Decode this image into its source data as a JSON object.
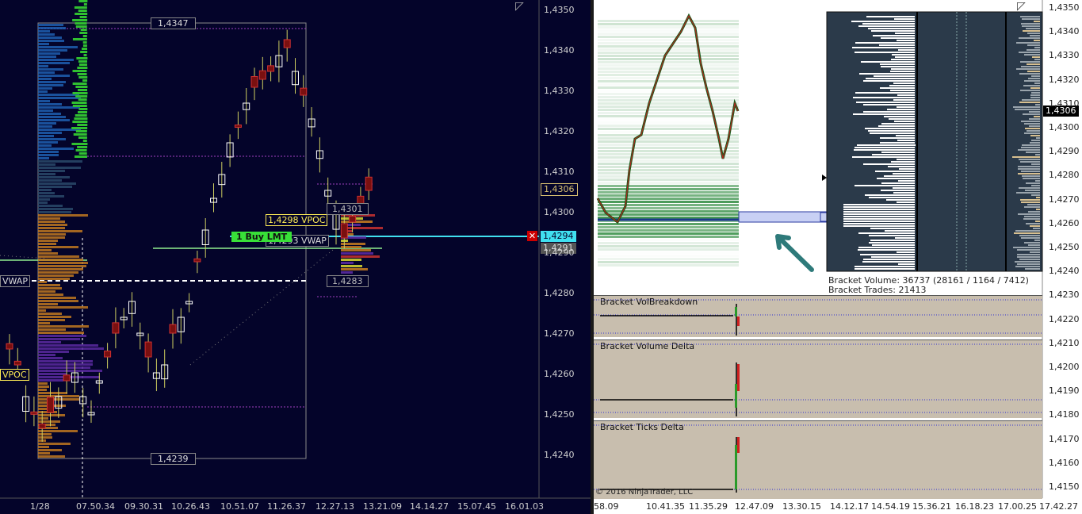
{
  "left_chart": {
    "y_ticks": [
      "1,4350",
      "1,4340",
      "1,4330",
      "1,4320",
      "1,4310",
      "1,4300",
      "1,4290",
      "1,4280",
      "1,4270",
      "1,4260",
      "1,4250",
      "1,4240"
    ],
    "x_ticks": [
      "1/28",
      "07.50.34",
      "09.30.31",
      "10.26.43",
      "10.51.07",
      "11.26.37",
      "12.27.13",
      "13.21.09",
      "14.14.27",
      "15.07.45",
      "16.01.03"
    ],
    "range_high_label": "1,4347",
    "range_low_label": "1,4239",
    "vpoc_label": "1,4298 VPOC",
    "vwap_label": "1,4293 VWAP",
    "order_label": "1  Buy LMT",
    "small_high_label": "1,4301",
    "small_low_label": "1,4283",
    "left_vwap_label": "VWAP",
    "left_vpoc_label": "VPOC",
    "price_tag_last": "1,4306",
    "price_tag_order": "1,4294",
    "price_tag_vwap": "1,4291"
  },
  "right_chart": {
    "y_ticks": [
      "1,4350",
      "1,4340",
      "1,4330",
      "1,4320",
      "1,4310",
      "1,4300",
      "1,4290",
      "1,4280",
      "1,4270",
      "1,4260",
      "1,4250",
      "1,4240",
      "1,4230",
      "1,4220",
      "1,4210",
      "1,4200",
      "1,4190",
      "1,4180",
      "1,4170",
      "1,4160",
      "1,4150"
    ],
    "x_ticks": [
      "58.09",
      "10.41.35",
      "11.35.29",
      "12.47.09",
      "13.30.15",
      "14.12.17",
      "14.54.19",
      "15.36.21",
      "16.18.23",
      "17.00.25",
      "17.42.27"
    ],
    "last_price_tag": "1,4306",
    "bracket_volume": "Bracket Volume: 36737 (28161 / 1164 / 7412)",
    "bracket_trades": "Bracket Trades: 21413",
    "subpanels": [
      "Bracket VolBreakdown",
      "Bracket Volume Delta",
      "Bracket Ticks Delta"
    ],
    "copyright": "© 2016 NinjaTrader, LLC"
  },
  "colors": {
    "left_bg": "#04042a",
    "bull_candle": "#ffffff",
    "bear_candle": "#c0392b",
    "vwap_line": "#ffffff",
    "order_line": "#40e0f0",
    "profile_panel": "#2b3a4a",
    "sub_bg": "#c8beae"
  }
}
